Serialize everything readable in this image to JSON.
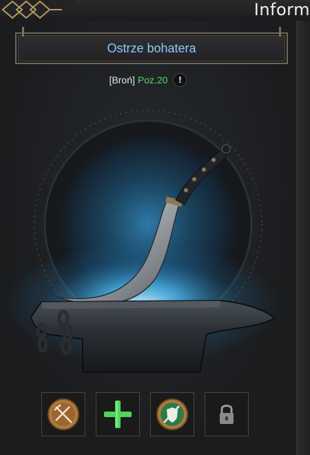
{
  "header": {
    "title": "Inform"
  },
  "item": {
    "name": "Ostrze bohatera",
    "type_label": "[Broń]",
    "level_label": "Poz.20",
    "info_badge": "!"
  },
  "icons": {
    "ornament": "diamond-knot-ornament",
    "weapon": "curved-blade-icon",
    "anvil": "anvil-icon",
    "slot_1": "crossed-weapons-icon",
    "slot_2": "plus-icon",
    "slot_3": "spear-shield-icon",
    "slot_4": "padlock-icon"
  },
  "colors": {
    "item_name": "#8ec8ff",
    "level": "#58d26b",
    "glow": "#3fb6ff",
    "plus": "#4fd65a",
    "medallion": "#b07a3c"
  }
}
